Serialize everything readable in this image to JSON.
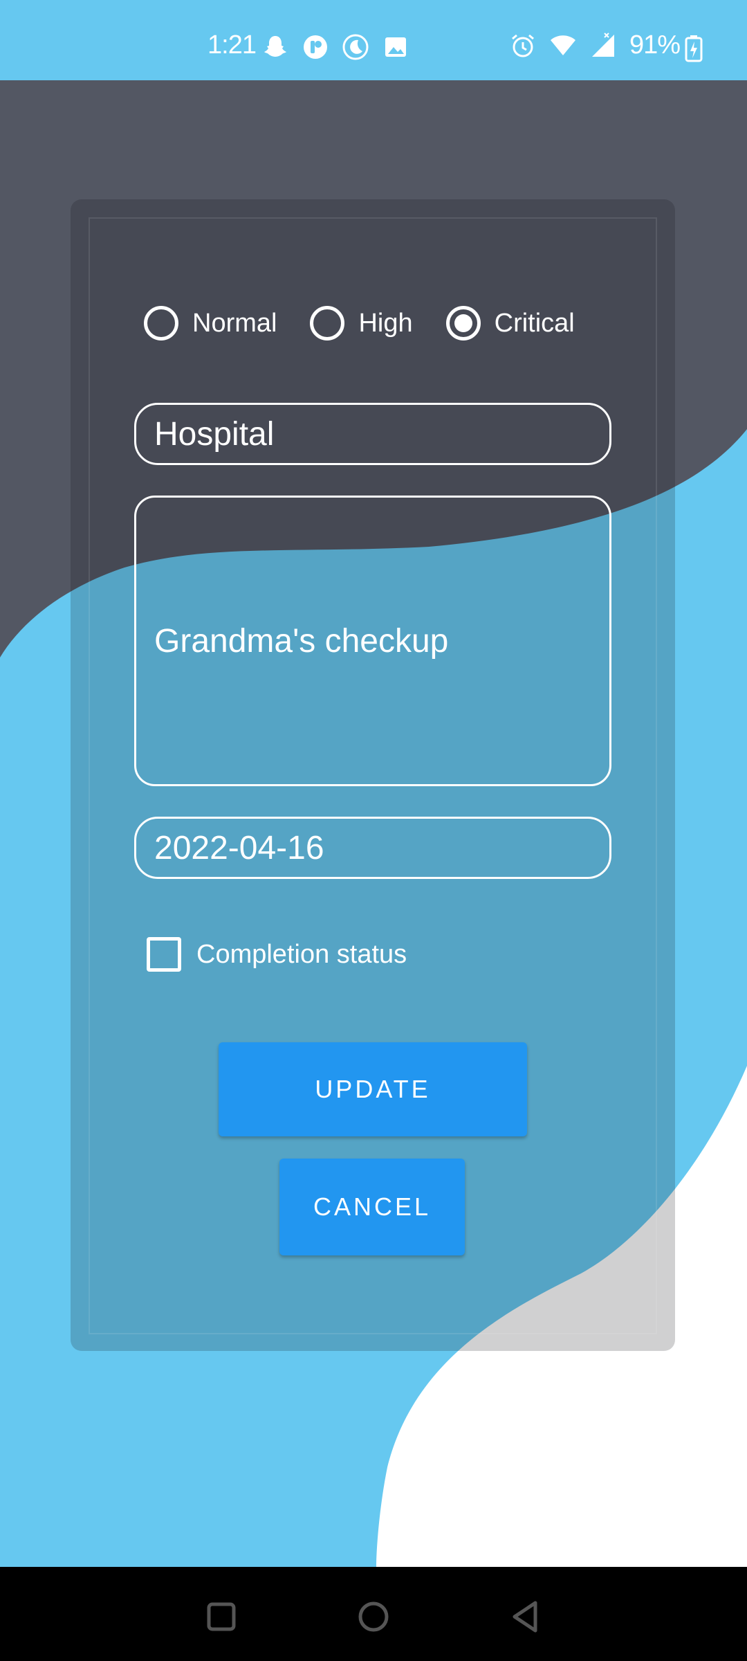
{
  "status_bar": {
    "time": "1:21",
    "battery": "91%",
    "left_icons": [
      "snapchat-icon",
      "app-icon",
      "moon-icon",
      "image-icon"
    ],
    "right_icons": [
      "alarm-icon",
      "wifi-icon",
      "signal-icon",
      "battery-charging-icon"
    ]
  },
  "priority": {
    "options": [
      {
        "label": "Normal",
        "selected": false
      },
      {
        "label": "High",
        "selected": false
      },
      {
        "label": "Critical",
        "selected": true
      }
    ]
  },
  "form": {
    "title_value": "Hospital",
    "description_value": "Grandma's checkup",
    "date_value": "2022-04-16",
    "completion_label": "Completion status",
    "completion_checked": false
  },
  "buttons": {
    "update_label": "UPDATE",
    "cancel_label": "CANCEL"
  },
  "nav": [
    "recents-icon",
    "home-icon",
    "back-icon"
  ],
  "colors": {
    "background_blue": "#66c8f0",
    "dark_wave": "#535763",
    "button_blue": "#2296f0",
    "white_wave": "#ffffff"
  }
}
